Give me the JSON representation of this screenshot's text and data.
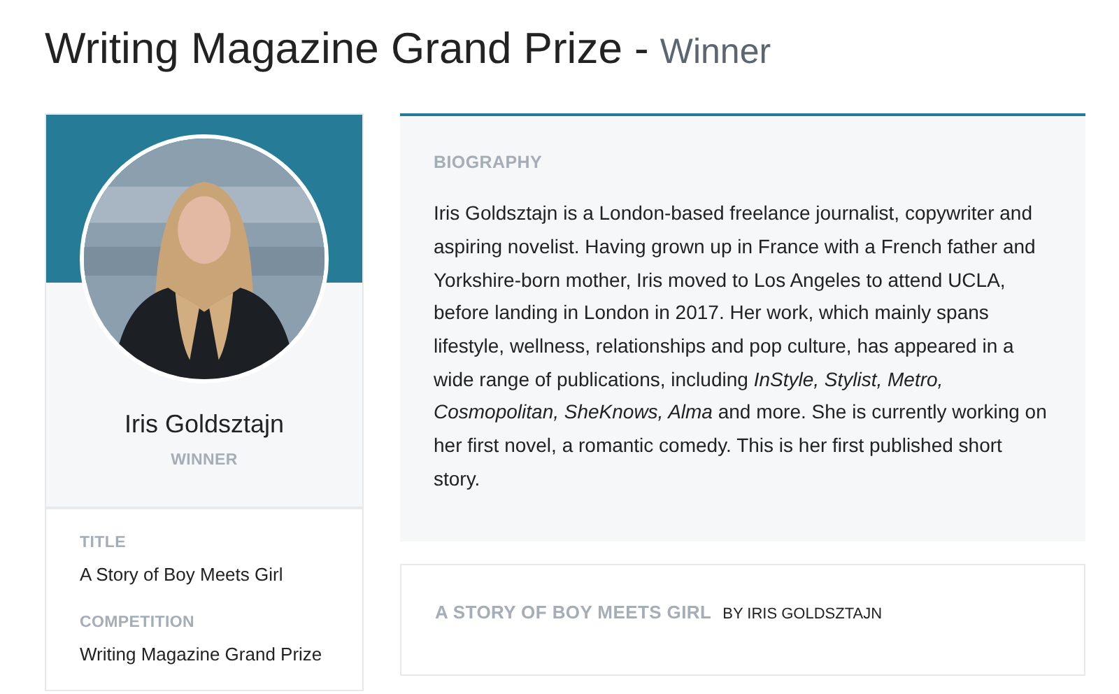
{
  "heading": {
    "title": "Writing Magazine Grand Prize -",
    "subtitle": "Winner"
  },
  "profile": {
    "name": "Iris Goldsztajn",
    "role": "WINNER",
    "details": [
      {
        "label": "TITLE",
        "value": "A Story of Boy Meets Girl"
      },
      {
        "label": "COMPETITION",
        "value": "Writing Magazine Grand Prize"
      }
    ]
  },
  "biography": {
    "heading": "BIOGRAPHY",
    "text": "Iris Goldsztajn is a London-based freelance journalist, copywriter and aspiring novelist. Having grown up in France with a French father and Yorkshire-born mother, Iris moved to Los Angeles to attend UCLA, before landing in London in 2017. Her work, which mainly spans lifestyle, wellness, relationships and pop culture, has appeared in a wide range of publications, including *InStyle, Stylist, Metro, Cosmopolitan, SheKnows, Alma* and more. She is currently working on her first novel, a romantic comedy. This is her first published short story."
  },
  "story": {
    "title": "A STORY OF BOY MEETS GIRL",
    "byline": "BY IRIS GOLDSZTAJN"
  }
}
